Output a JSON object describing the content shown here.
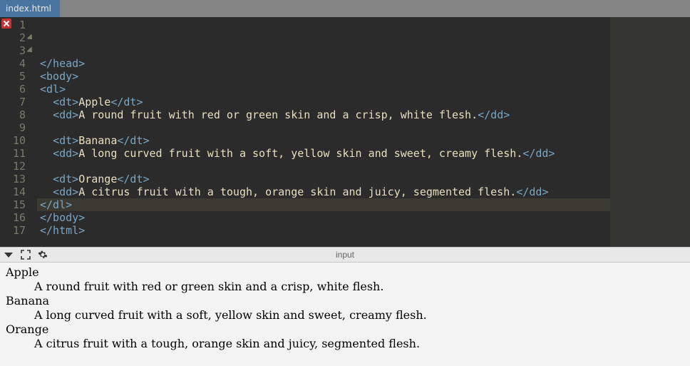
{
  "tab": {
    "title": "index.html"
  },
  "toolbar": {
    "label": "input"
  },
  "gutter_lines": [
    "1",
    "2",
    "3",
    "4",
    "5",
    "6",
    "7",
    "8",
    "9",
    "10",
    "11",
    "12",
    "13",
    "14",
    "15",
    "16",
    "17"
  ],
  "fold_markers_at": [
    2,
    3
  ],
  "highlight_line_index": 11,
  "code_tokens": [
    [
      [
        "tag",
        "</head>"
      ]
    ],
    [
      [
        "tag",
        "<body>"
      ]
    ],
    [
      [
        "tag",
        "<dl>"
      ]
    ],
    [
      [
        "txt",
        "  "
      ],
      [
        "tag",
        "<dt>"
      ],
      [
        "txt",
        "Apple"
      ],
      [
        "tag",
        "</dt>"
      ]
    ],
    [
      [
        "txt",
        "  "
      ],
      [
        "tag",
        "<dd>"
      ],
      [
        "txt",
        "A round fruit with red or green skin and a crisp, white flesh."
      ],
      [
        "tag",
        "</dd>"
      ]
    ],
    [],
    [
      [
        "txt",
        "  "
      ],
      [
        "tag",
        "<dt>"
      ],
      [
        "txt",
        "Banana"
      ],
      [
        "tag",
        "</dt>"
      ]
    ],
    [
      [
        "txt",
        "  "
      ],
      [
        "tag",
        "<dd>"
      ],
      [
        "txt",
        "A long curved fruit with a soft, yellow skin and sweet, creamy flesh."
      ],
      [
        "tag",
        "</dd>"
      ]
    ],
    [],
    [
      [
        "txt",
        "  "
      ],
      [
        "tag",
        "<dt>"
      ],
      [
        "txt",
        "Orange"
      ],
      [
        "tag",
        "</dt>"
      ]
    ],
    [
      [
        "txt",
        "  "
      ],
      [
        "tag",
        "<dd>"
      ],
      [
        "txt",
        "A citrus fruit with a tough, orange skin and juicy, segmented flesh."
      ],
      [
        "tag",
        "</dd>"
      ]
    ],
    [
      [
        "tag",
        "</dl>"
      ]
    ],
    [
      [
        "tag",
        "</body>"
      ]
    ],
    [
      [
        "tag",
        "</html>"
      ]
    ],
    [],
    [],
    []
  ],
  "output": {
    "items": [
      {
        "term": "Apple",
        "def": "A round fruit with red or green skin and a crisp, white flesh."
      },
      {
        "term": "Banana",
        "def": "A long curved fruit with a soft, yellow skin and sweet, creamy flesh."
      },
      {
        "term": "Orange",
        "def": "A citrus fruit with a tough, orange skin and juicy, segmented flesh."
      }
    ]
  },
  "colors": {
    "tab_bg": "#4a74a0",
    "editor_bg": "#2b2b2b",
    "gutter_fg": "#7a7a6a",
    "tag_fg": "#7aa6c2",
    "text_fg": "#e8dfc0",
    "error_bg": "#c43434"
  }
}
